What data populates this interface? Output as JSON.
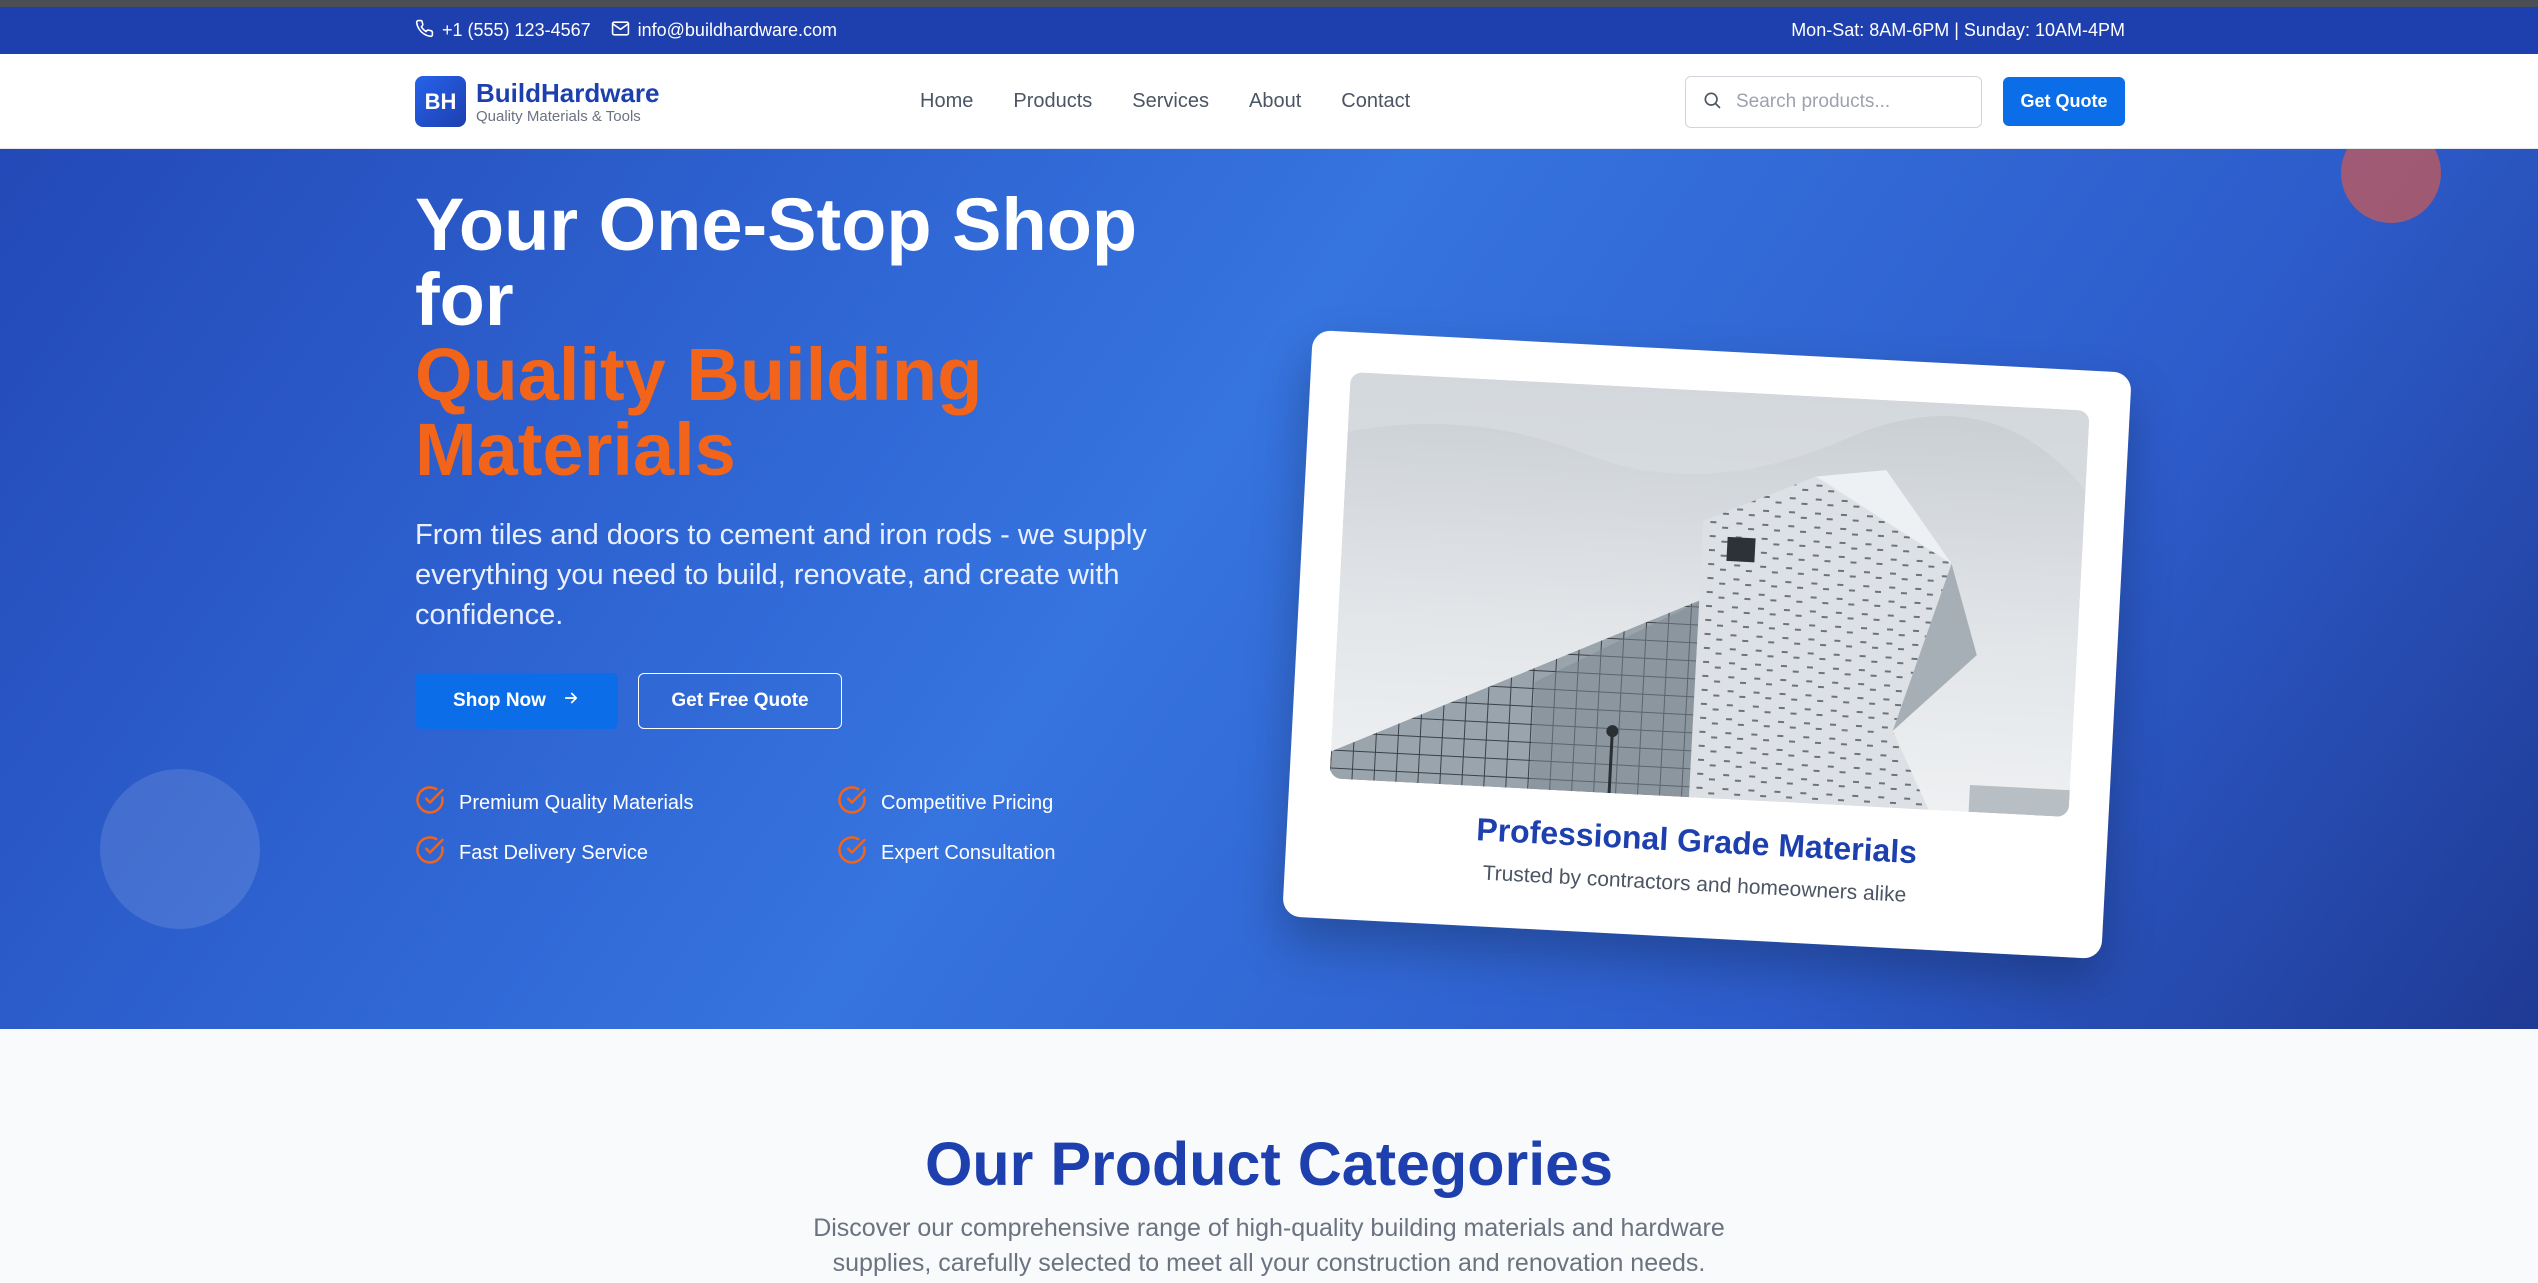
{
  "topbar": {
    "phone": "+1 (555) 123-4567",
    "email": "info@buildhardware.com",
    "hours": "Mon-Sat: 8AM-6PM | Sunday: 10AM-4PM"
  },
  "brand": {
    "mark": "BH",
    "name": "BuildHardware",
    "tagline": "Quality Materials & Tools"
  },
  "nav": {
    "items": [
      {
        "label": "Home"
      },
      {
        "label": "Products"
      },
      {
        "label": "Services"
      },
      {
        "label": "About"
      },
      {
        "label": "Contact"
      }
    ]
  },
  "search": {
    "placeholder": "Search products...",
    "value": ""
  },
  "header_cta": "Get Quote",
  "hero": {
    "title_line1": "Your One-Stop Shop for",
    "title_accent": "Quality Building Materials",
    "subtitle": "From tiles and doors to cement and iron rods - we supply everything you need to build, renovate, and create with confidence.",
    "primary_button": "Shop Now",
    "secondary_button": "Get Free Quote",
    "features": [
      {
        "label": "Premium Quality Materials"
      },
      {
        "label": "Competitive Pricing"
      },
      {
        "label": "Fast Delivery Service"
      },
      {
        "label": "Expert Consultation"
      }
    ]
  },
  "showcase": {
    "title": "Professional Grade Materials",
    "subtitle": "Trusted by contractors and homeowners alike"
  },
  "categories": {
    "title": "Our Product Categories",
    "description": "Discover our comprehensive range of high-quality building materials and hardware supplies, carefully selected to meet all your construction and renovation needs."
  },
  "colors": {
    "topbar": "#1e3fae",
    "primary": "#0b6ee8",
    "accent": "#f26419",
    "heading": "#1e40af"
  },
  "icons": {
    "phone": "phone-icon",
    "email": "mail-icon",
    "search": "search-icon",
    "arrow": "arrow-right-icon",
    "check": "check-circle-icon"
  }
}
